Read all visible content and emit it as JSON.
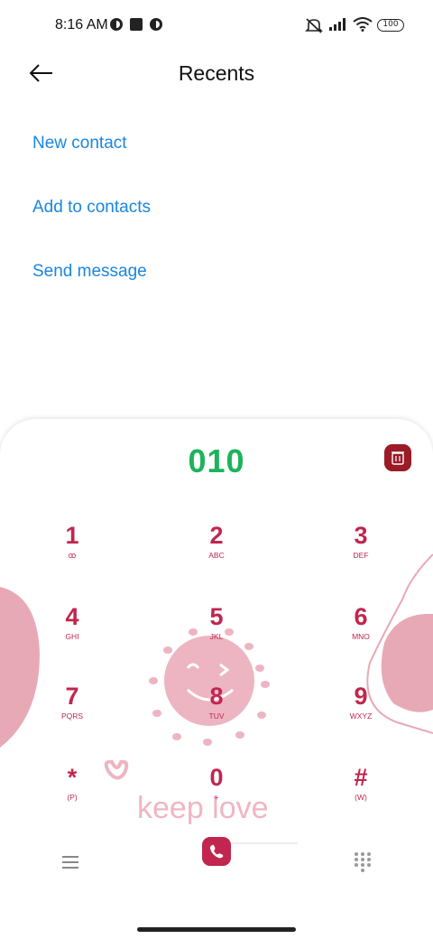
{
  "status_bar": {
    "time": "8:16 AM",
    "battery": "100",
    "icons": [
      "circle-notification-icon",
      "square-notification-icon",
      "circle-notification-icon",
      "mute-icon",
      "signal-icon",
      "wifi-icon",
      "battery-icon"
    ]
  },
  "header": {
    "title": "Recents",
    "back_icon": "back-arrow-icon"
  },
  "actions": {
    "new_contact": "New contact",
    "add_to_contacts": "Add to contacts",
    "send_message": "Send message"
  },
  "dialer": {
    "number": "010",
    "keys": [
      {
        "digit": "1",
        "letters": "ꝏ"
      },
      {
        "digit": "2",
        "letters": "ABC"
      },
      {
        "digit": "3",
        "letters": "DEF"
      },
      {
        "digit": "4",
        "letters": "GHI"
      },
      {
        "digit": "5",
        "letters": "JKL"
      },
      {
        "digit": "6",
        "letters": "MNO"
      },
      {
        "digit": "7",
        "letters": "PQRS"
      },
      {
        "digit": "8",
        "letters": "TUV"
      },
      {
        "digit": "9",
        "letters": "WXYZ"
      },
      {
        "digit": "*",
        "letters": "(P)"
      },
      {
        "digit": "0",
        "letters": "+"
      },
      {
        "digit": "#",
        "letters": "(W)"
      }
    ],
    "theme_text": "keep love",
    "icons": [
      "delete-icon",
      "phone-icon",
      "menu-icon",
      "keypad-icon"
    ]
  },
  "colors": {
    "accent_link": "#1a86e0",
    "number": "#1cb45b",
    "key": "#c0264f",
    "delete": "#9b1b27",
    "decoration": "#e8a9b7"
  }
}
